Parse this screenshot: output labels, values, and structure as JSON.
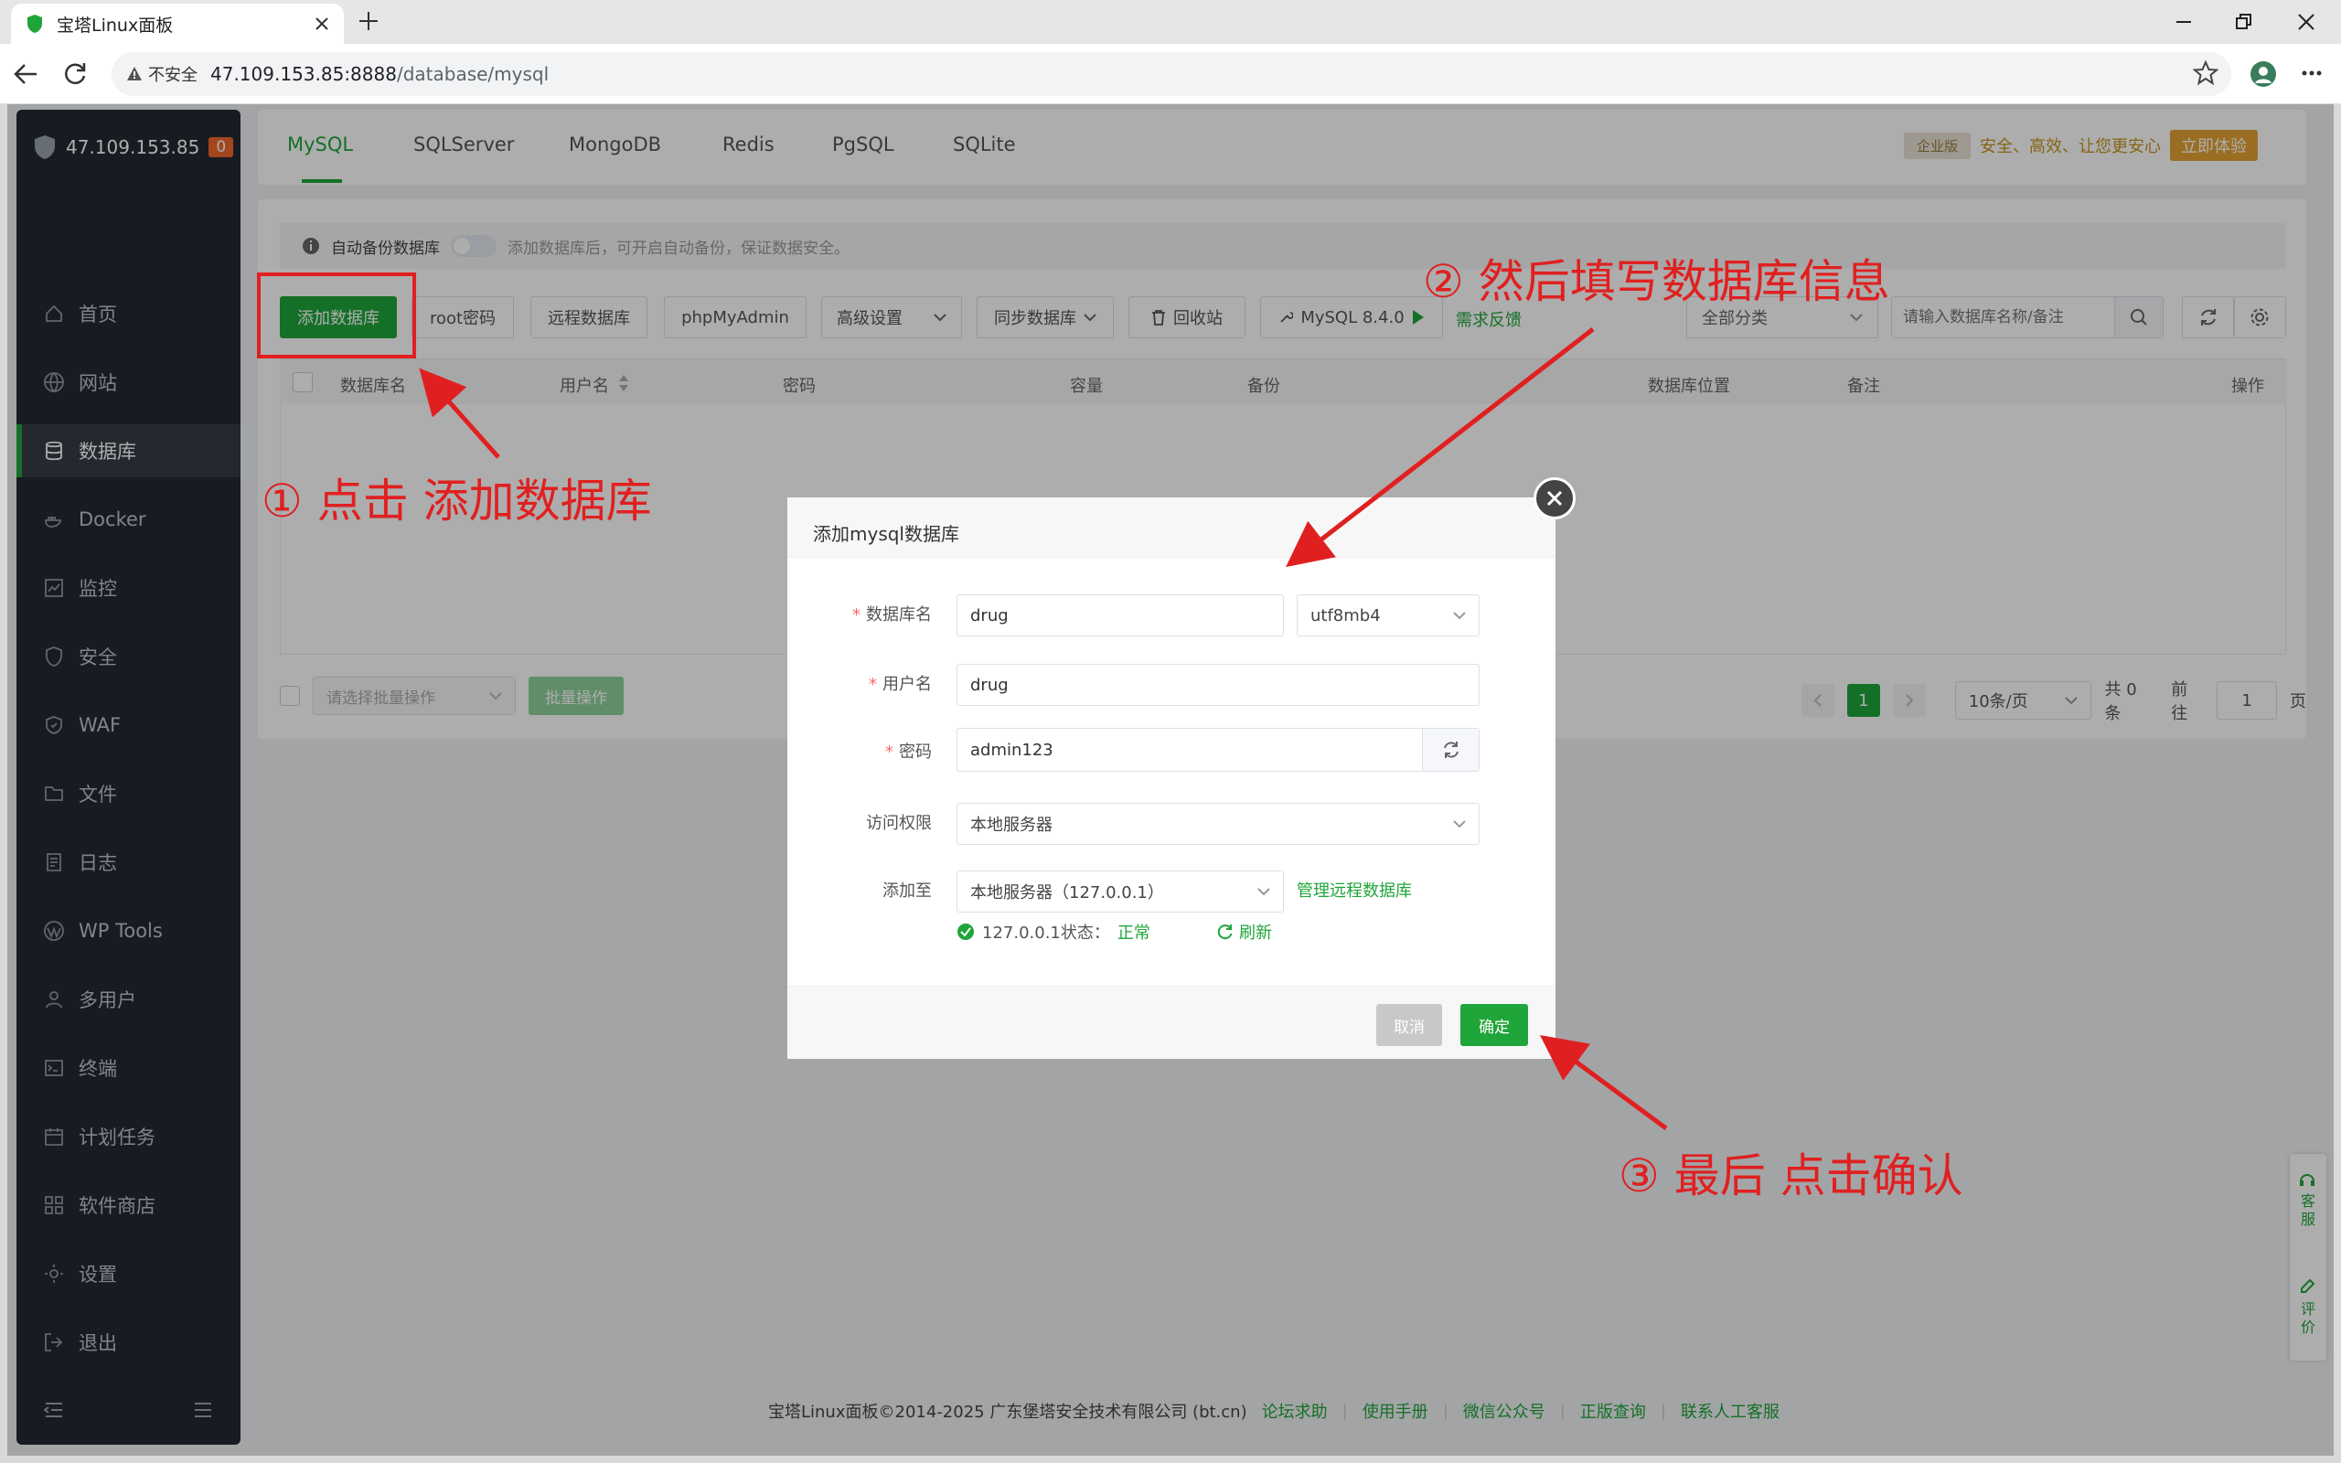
{
  "browser": {
    "tab_title": "宝塔Linux面板",
    "not_secure": "不安全",
    "url_host": "47.109.153.85:8888",
    "url_path": "/database/mysql"
  },
  "sidebar": {
    "server_ip": "47.109.153.85",
    "badge": "0",
    "items": [
      "首页",
      "网站",
      "数据库",
      "Docker",
      "监控",
      "安全",
      "WAF",
      "文件",
      "日志",
      "WP Tools",
      "多用户",
      "终端",
      "计划任务",
      "软件商店",
      "设置",
      "退出"
    ],
    "active": 2
  },
  "top_tabs": [
    "MySQL",
    "SQLServer",
    "MongoDB",
    "Redis",
    "PgSQL",
    "SQLite"
  ],
  "enterprise": {
    "badge": "企业版",
    "slogan": "安全、高效、让您更安心",
    "button": "立即体验"
  },
  "notice": {
    "label": "自动备份数据库",
    "hint": "添加数据库后，可开启自动备份，保证数据安全。"
  },
  "toolbar": {
    "add_db": "添加数据库",
    "root_pw": "root密码",
    "remote_db": "远程数据库",
    "phpmyadmin": "phpMyAdmin",
    "advanced": "高级设置",
    "sync_db": "同步数据库",
    "recycle": "回收站",
    "mysql_version": "MySQL 8.4.0",
    "feedback": "需求反馈",
    "category": "全部分类",
    "search_placeholder": "请输入数据库名称/备注"
  },
  "table": {
    "columns": [
      "数据库名",
      "用户名",
      "密码",
      "容量",
      "备份",
      "数据库位置",
      "备注",
      "操作"
    ]
  },
  "batch": {
    "select_placeholder": "请选择批量操作",
    "button": "批量操作"
  },
  "pager": {
    "current": "1",
    "page_size": "10条/页",
    "total": "共 0 条",
    "goto_label": "前往",
    "goto_value": "1",
    "page_unit": "页"
  },
  "modal": {
    "title": "添加mysql数据库",
    "db_name_label": "数据库名",
    "db_name": "drug",
    "charset": "utf8mb4",
    "user_label": "用户名",
    "user": "drug",
    "pw_label": "密码",
    "password": "admin123",
    "access_label": "访问权限",
    "access": "本地服务器",
    "add_to_label": "添加至",
    "add_to": "本地服务器（127.0.0.1）",
    "manage_remote": "管理远程数据库",
    "status_label": "127.0.0.1状态：",
    "status_value": "正常",
    "refresh": "刷新",
    "cancel": "取消",
    "confirm": "确定"
  },
  "annotations": {
    "step1": "① 点击 添加数据库",
    "step2": "② 然后填写数据库信息",
    "step3": "③ 最后 点击确认"
  },
  "footer": {
    "copyright": "宝塔Linux面板©2014-2025 广东堡塔安全技术有限公司 (bt.cn)",
    "links": [
      "论坛求助",
      "使用手册",
      "微信公众号",
      "正版查询",
      "联系人工客服"
    ]
  },
  "float": {
    "service": "客服",
    "rate": "评价"
  },
  "colors": {
    "brand_green": "#20a53a",
    "annotation_red": "#e02020",
    "sidebar_bg": "#242a33"
  }
}
